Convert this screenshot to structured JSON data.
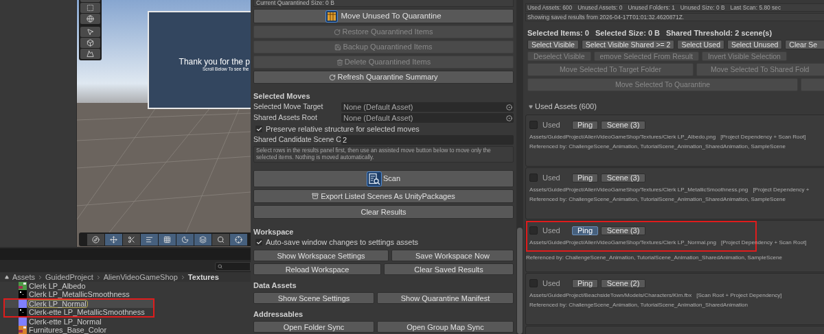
{
  "scene_view": {
    "canvas_title": "Thank you for the p",
    "canvas_subtitle": "Scroll Below To see the",
    "toolbar": [
      {
        "on": false
      },
      {
        "on": true
      },
      {
        "on": false
      },
      {
        "on": true
      },
      {
        "on": true
      },
      {
        "on": true
      },
      {
        "on": true
      },
      {
        "on": false
      },
      {
        "on": true
      }
    ]
  },
  "project": {
    "breadcrumb": [
      {
        "label": "Assets",
        "current": false
      },
      {
        "label": "GuidedProject",
        "current": false
      },
      {
        "label": "AlienVideoGameShop",
        "current": false
      },
      {
        "label": "Textures",
        "current": true
      }
    ],
    "files": [
      {
        "name": "Clerk LP_Albedo",
        "kind": "albedo",
        "color": "#4c9a46",
        "selected": false
      },
      {
        "name": "Clerk LP_MetallicSmoothness",
        "kind": "mask",
        "selected": false
      },
      {
        "name": "Clerk LP_Normal",
        "kind": "normal",
        "selected": true
      },
      {
        "name": "Clerk-ette LP_MetallicSmoothness",
        "kind": "mask",
        "selected": false
      },
      {
        "name": "Clerk-ette LP_Normal",
        "kind": "normal",
        "selected": false
      },
      {
        "name": "Furnitures_Base_Color",
        "kind": "albedo",
        "color": "#d9822b",
        "selected": false
      }
    ]
  },
  "tool": {
    "quarantine_size": "Current Quarantined Size: 0 B",
    "quarantine_buttons": [
      {
        "label": "Move Unused To Quarantine",
        "disabled": false
      },
      {
        "label": "Restore Quarantined Items",
        "disabled": true
      },
      {
        "label": "Backup Quarantined Items",
        "disabled": true
      },
      {
        "label": "Delete Quarantined Items",
        "disabled": true
      },
      {
        "label": "Refresh Quarantine Summary",
        "disabled": false
      }
    ],
    "selected_moves": {
      "title": "Selected Moves",
      "fields": [
        {
          "label": "Selected Move Target",
          "value": "None (Default Asset)"
        },
        {
          "label": "Shared Assets Root",
          "value": "None (Default Asset)"
        }
      ],
      "preserve": {
        "label": "Preserve relative structure for selected moves",
        "checked": true
      },
      "scene_count": {
        "label": "Shared Candidate Scene C",
        "value": "2"
      },
      "help": "Select rows in the results panel first, then use an assisted move button below to move only the selected items. Nothing is moved automatically."
    },
    "scan_button": "Scan",
    "actions": [
      "Export Listed Scenes As UnityPackages",
      "Clear Results"
    ],
    "sections": [
      {
        "title": "Workspace",
        "checkbox": {
          "label": "Auto-save window changes to settings assets",
          "checked": true
        },
        "rows": [
          [
            "Show Workspace Settings",
            "Save Workspace Now"
          ],
          [
            "Reload Workspace",
            "Clear Saved Results"
          ]
        ]
      },
      {
        "title": "Data Assets",
        "rows": [
          [
            "Show Scene Settings",
            "Show Quarantine Manifest"
          ]
        ]
      },
      {
        "title": "Addressables",
        "rows": [
          [
            "Open Folder Sync",
            "Open Group Map Sync"
          ]
        ]
      }
    ]
  },
  "results": {
    "stats": [
      "Used Assets: 600",
      "Unused Assets: 0",
      "Unused Folders: 1",
      "Unused Size: 0 B",
      "Last Scan: 5.80 sec"
    ],
    "saved_note": "Showing saved results from 2026-04-17T01:01:32.4620871Z.",
    "selection": [
      "Selected Items: 0",
      "Selected Size: 0 B",
      "Shared Threshold: 2 scene(s)"
    ],
    "button_rows": [
      [
        {
          "label": "Select Visible",
          "disabled": false
        },
        {
          "label": "Select Visible Shared >= 2",
          "disabled": false
        },
        {
          "label": "Select Used",
          "disabled": false
        },
        {
          "label": "Select Unused",
          "disabled": false
        },
        {
          "label": "Clear Se",
          "disabled": false
        }
      ],
      [
        {
          "label": "Deselect Visible",
          "disabled": true
        },
        {
          "label": "emove Selected From Result",
          "disabled": true
        },
        {
          "label": "Invert Visible Selection",
          "disabled": true
        }
      ],
      [
        {
          "label": "Move Selected To Target Folder",
          "disabled": true
        },
        {
          "label": "Move Selected To Shared Fold",
          "disabled": true
        }
      ],
      [
        {
          "label": "Move Selected To Quarantine",
          "disabled": true
        },
        {
          "disabled": true
        }
      ]
    ],
    "group": {
      "title": "Used Assets (600)",
      "expanded": true
    },
    "items": [
      {
        "checked": false,
        "status": "Used",
        "ping": "Ping",
        "ping_selected": false,
        "scenes": "Scene (3)",
        "path": "Assets/GuidedProject/AlienVideoGameShop/Textures/Clerk LP_Albedo.png",
        "tag": "[Project Dependency + Scan Root]",
        "refs": "Referenced by: ChallengeScene_Animation, TutorialScene_Animation_SharedAnimation, SampleScene"
      },
      {
        "checked": false,
        "status": "Used",
        "ping": "Ping",
        "ping_selected": false,
        "scenes": "Scene (3)",
        "path": "Assets/GuidedProject/AlienVideoGameShop/Textures/Clerk LP_MetallicSmoothness.png",
        "tag": "[Project Dependency +",
        "refs": "Referenced by: ChallengeScene_Animation, TutorialScene_Animation_SharedAnimation, SampleScene"
      },
      {
        "checked": false,
        "status": "Used",
        "ping": "Ping",
        "ping_selected": true,
        "scenes": "Scene (3)",
        "path": "Assets/GuidedProject/AlienVideoGameShop/Textures/Clerk LP_Normal.png",
        "tag": "[Project Dependency + Scan Root]",
        "refs": "Referenced by: ChallengeScene_Animation, TutorialScene_Animation_SharedAnimation, SampleScene"
      },
      {
        "checked": false,
        "status": "Used",
        "ping": "Ping",
        "ping_selected": false,
        "scenes": "Scene (2)",
        "path": "Assets/GuidedProject/BeachsideTown/Models/Characters/Kim.fbx",
        "tag": "[Scan Root + Project Dependency]",
        "refs": "Referenced by: ChallengeScene_Animation, TutorialScene_Animation_SharedAnimation"
      }
    ]
  }
}
